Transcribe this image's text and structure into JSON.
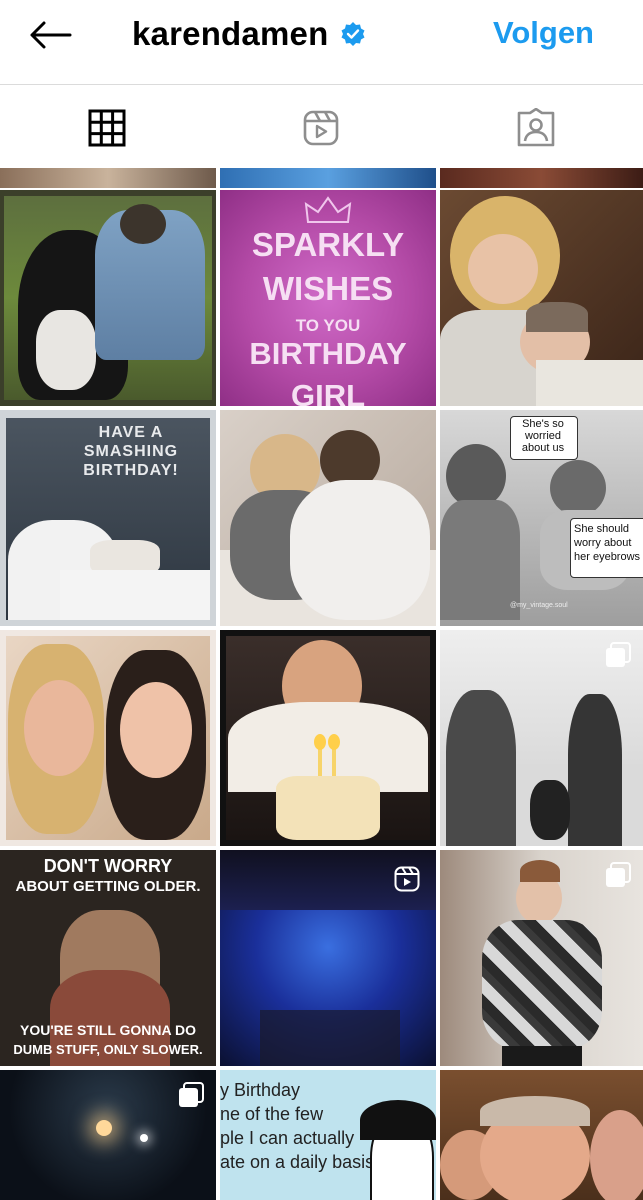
{
  "header": {
    "username": "karendamen",
    "follow_label": "Volgen"
  },
  "tabs": {
    "items": [
      {
        "icon": "grid-icon",
        "active": true
      },
      {
        "icon": "reels-icon",
        "active": false
      },
      {
        "icon": "tagged-icon",
        "active": false
      }
    ]
  },
  "posts": {
    "sparkly": {
      "line1": "SPARKLY",
      "line2": "WISHES",
      "line3": "TO YOU",
      "line4": "BIRTHDAY",
      "line5": "GIRL"
    },
    "smashing": {
      "line1": "HAVE A",
      "line2": "SMASHING",
      "line3": "BIRTHDAY!"
    },
    "vintage": {
      "bubble1": "She's so worried about us",
      "bubble2": "She should worry about her eyebrows",
      "credit": "@my_vintage.soul"
    },
    "dontworry": {
      "top1": "DON'T WORRY",
      "top2": "ABOUT GETTING OLDER.",
      "bottom1": "YOU'RE STILL GONNA DO",
      "bottom2": "DUMB STUFF, ONLY SLOWER."
    },
    "birthday_text": {
      "line1": "y Birthday",
      "line2": "ne of the few",
      "line3": "ple I can actually",
      "line4": "ate on a daily basis"
    }
  },
  "colors": {
    "accent": "#1c9bef",
    "verified": "#1c9bef",
    "divider": "#dbdbdb"
  }
}
